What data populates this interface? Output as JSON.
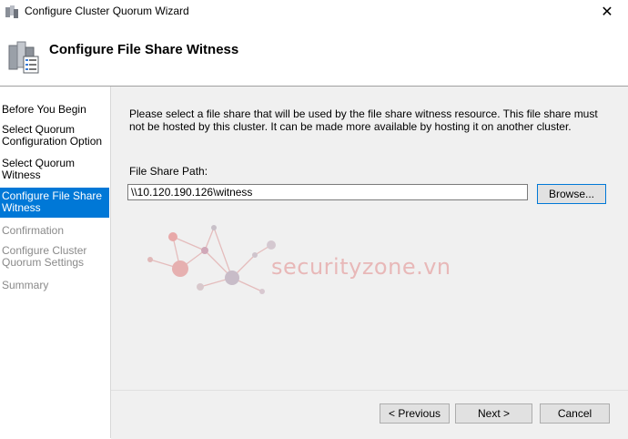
{
  "window": {
    "title": "Configure Cluster Quorum Wizard",
    "close_glyph": "✕"
  },
  "header": {
    "heading": "Configure File Share Witness",
    "icon": "cluster-wizard-icon"
  },
  "sidebar": {
    "steps": [
      {
        "label_1": "Before You Begin",
        "label_2": "",
        "state": "done"
      },
      {
        "label_1": "Select Quorum",
        "label_2": "Configuration Option",
        "state": "done"
      },
      {
        "label_1": "Select Quorum",
        "label_2": "Witness",
        "state": "done"
      },
      {
        "label_1": "Configure File Share",
        "label_2": "Witness",
        "state": "active"
      },
      {
        "label_1": "Confirmation",
        "label_2": "",
        "state": "pending"
      },
      {
        "label_1": "Configure Cluster",
        "label_2": "Quorum Settings",
        "state": "pending"
      },
      {
        "label_1": "Summary",
        "label_2": "",
        "state": "pending"
      }
    ]
  },
  "main": {
    "description": "Please select a file share that will be used by the file share witness resource.  This file share must not be hosted by this cluster.  It can be made more available by hosting it on another cluster.",
    "path_label": "File Share Path:",
    "path_value": "\\\\10.120.190.126\\witness",
    "browse_label": "Browse..."
  },
  "watermark": {
    "text": "securityzone.vn"
  },
  "footer": {
    "previous_label": "< Previous",
    "next_label": "Next >",
    "cancel_label": "Cancel"
  },
  "colors": {
    "accent": "#0078d7",
    "content_bg": "#f0f0f0",
    "pending_text": "#8a8a8a"
  }
}
